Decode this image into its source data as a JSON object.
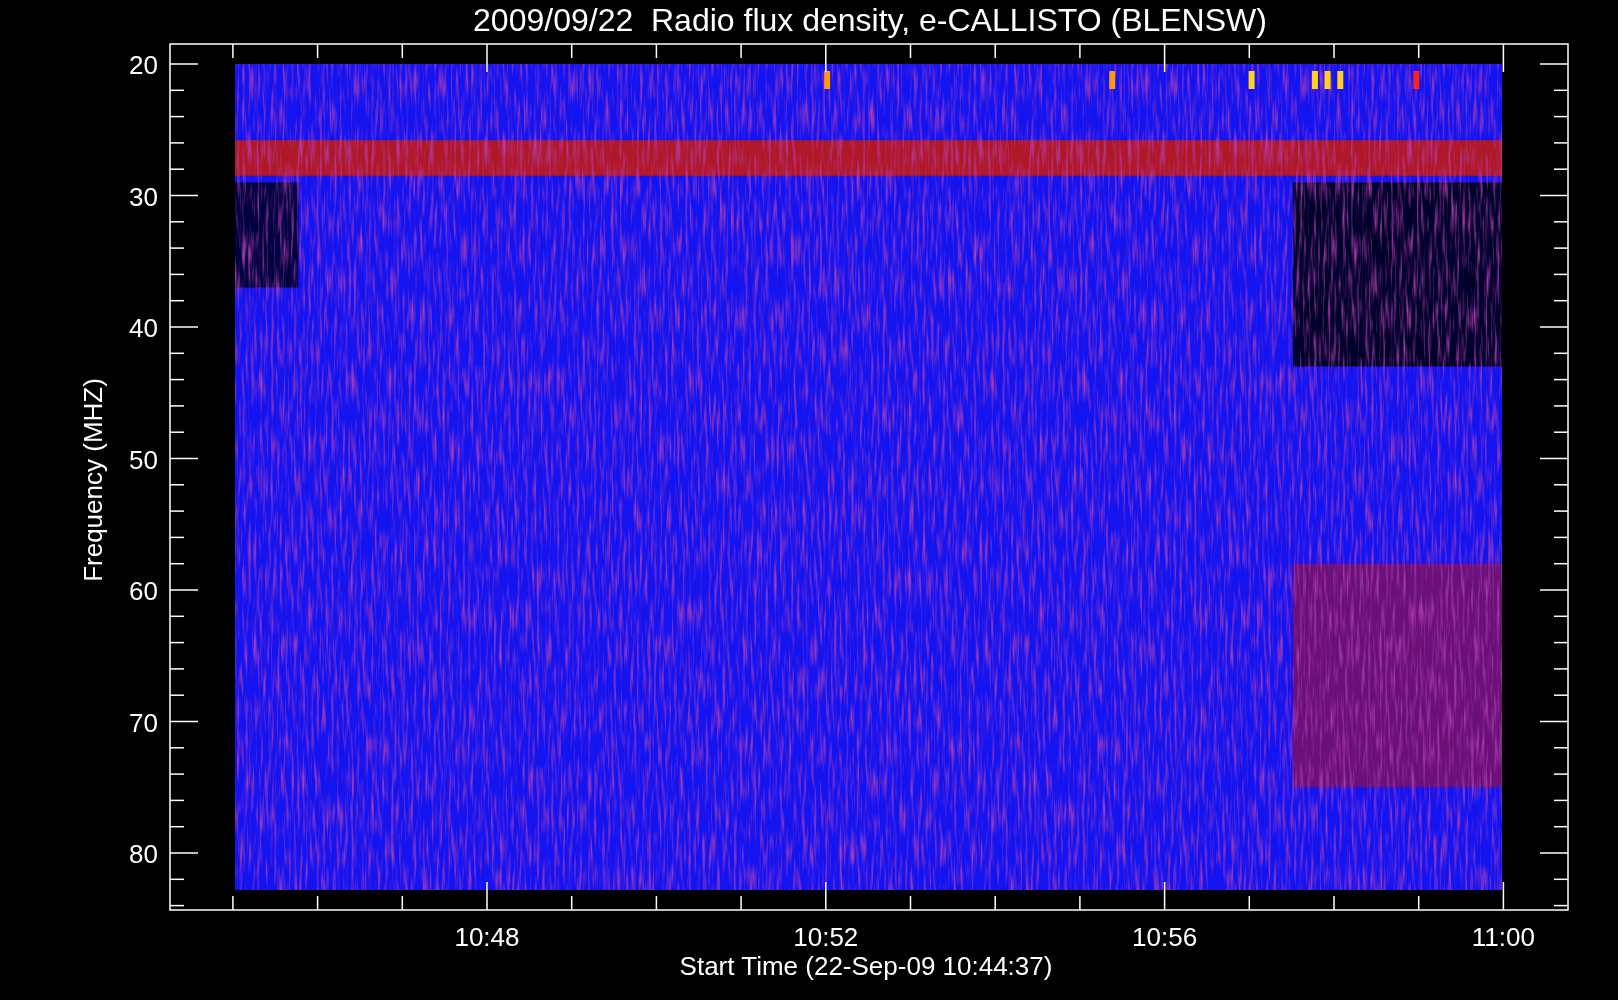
{
  "title": "2009/09/22  Radio flux density, e-CALLISTO (BLENSW)",
  "ylabel": "Frequency (MHZ)",
  "xlabel": "Start Time (22-Sep-09 10:44:37)",
  "yticks": [
    "20",
    "30",
    "40",
    "50",
    "60",
    "70",
    "80"
  ],
  "xticks": [
    "10:48",
    "10:52",
    "10:56",
    "11:00"
  ]
}
